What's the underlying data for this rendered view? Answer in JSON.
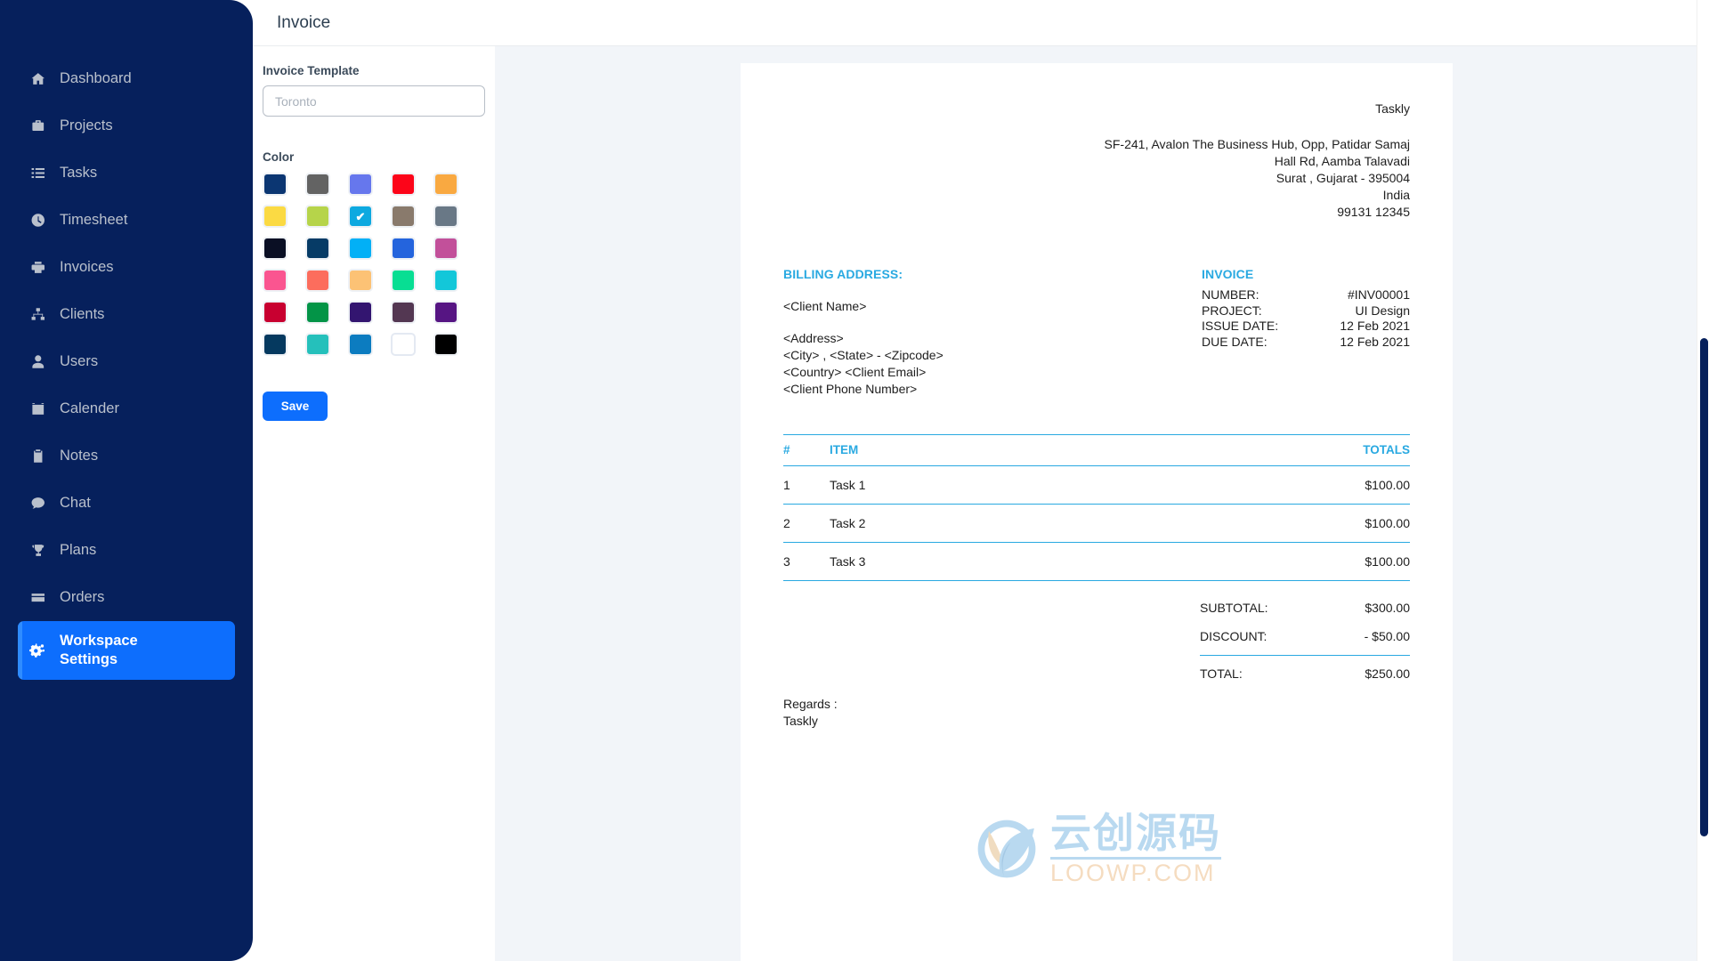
{
  "sidebar": {
    "items": [
      {
        "label": "Dashboard",
        "icon": "home-icon",
        "active": false
      },
      {
        "label": "Projects",
        "icon": "briefcase-icon",
        "active": false
      },
      {
        "label": "Tasks",
        "icon": "list-icon",
        "active": false
      },
      {
        "label": "Timesheet",
        "icon": "clock-icon",
        "active": false
      },
      {
        "label": "Invoices",
        "icon": "printer-icon",
        "active": false
      },
      {
        "label": "Clients",
        "icon": "sitemap-icon",
        "active": false
      },
      {
        "label": "Users",
        "icon": "user-icon",
        "active": false
      },
      {
        "label": "Calender",
        "icon": "calendar-icon",
        "active": false
      },
      {
        "label": "Notes",
        "icon": "clipboard-icon",
        "active": false
      },
      {
        "label": "Chat",
        "icon": "chat-bubble-icon",
        "active": false
      },
      {
        "label": "Plans",
        "icon": "trophy-icon",
        "active": false
      },
      {
        "label": "Orders",
        "icon": "credit-card-icon",
        "active": false
      },
      {
        "label": "Workspace Settings",
        "icon": "gears-icon",
        "active": true
      }
    ],
    "background_color": "#06205c",
    "active_color": "#0d6efd",
    "active_accent_color": "#2f8cff"
  },
  "header": {
    "title": "Invoice"
  },
  "settings": {
    "template_label": "Invoice Template",
    "template_value": "",
    "template_placeholder": "Toronto",
    "color_label": "Color",
    "save_label": "Save",
    "selected_color": "#0da9e0",
    "selected_index": 7,
    "swatches": [
      "#0b3672",
      "#636363",
      "#6677ed",
      "#fc0519",
      "#f9a941",
      "#fbda43",
      "#b6d44a",
      "#0da9e0",
      "#897a6c",
      "#697886",
      "#0a0f24",
      "#063b66",
      "#02b0f6",
      "#2464dd",
      "#c2509a",
      "#fa5590",
      "#fc6d5d",
      "#fcc275",
      "#08de93",
      "#13c7d9",
      "#c80030",
      "#039447",
      "#331570",
      "#533752",
      "#561583",
      "#05395f",
      "#25c0bb",
      "#0c7cc0",
      "#ffffff",
      "#000000"
    ]
  },
  "invoice": {
    "company": {
      "name": "Taskly",
      "address_lines": [
        "SF-241, Avalon The Business Hub, Opp, Patidar Samaj",
        "Hall Rd, Aamba Talavadi",
        "Surat , Gujarat - 395004",
        "India",
        "99131 12345"
      ]
    },
    "billing": {
      "heading": "BILLING ADDRESS:",
      "client_name": "<Client Name>",
      "lines": [
        "<Address>",
        "<City> , <State> - <Zipcode>",
        "<Country> <Client Email>",
        "<Client Phone Number>"
      ]
    },
    "meta": {
      "heading": "INVOICE",
      "rows": [
        {
          "key": "NUMBER:",
          "value": "#INV00001"
        },
        {
          "key": "PROJECT:",
          "value": "UI Design"
        },
        {
          "key": "ISSUE DATE:",
          "value": "12 Feb 2021"
        },
        {
          "key": "DUE DATE:",
          "value": "12 Feb 2021"
        }
      ]
    },
    "table": {
      "columns": [
        "#",
        "ITEM",
        "TOTALS"
      ],
      "rows": [
        {
          "index": "1",
          "item": "Task 1",
          "total": "$100.00"
        },
        {
          "index": "2",
          "item": "Task 2",
          "total": "$100.00"
        },
        {
          "index": "3",
          "item": "Task 3",
          "total": "$100.00"
        }
      ]
    },
    "totals": [
      {
        "label": "SUBTOTAL:",
        "value": "$300.00"
      },
      {
        "label": "DISCOUNT:",
        "value": "- $50.00"
      },
      {
        "label": "TOTAL:",
        "value": "$250.00"
      }
    ],
    "footer": {
      "regards_label": "Regards :",
      "signature": "Taskly"
    },
    "accent_color": "#29a9e1"
  },
  "watermark": {
    "cn_text": "云创源码",
    "domain_text": "LOOWP.COM"
  }
}
